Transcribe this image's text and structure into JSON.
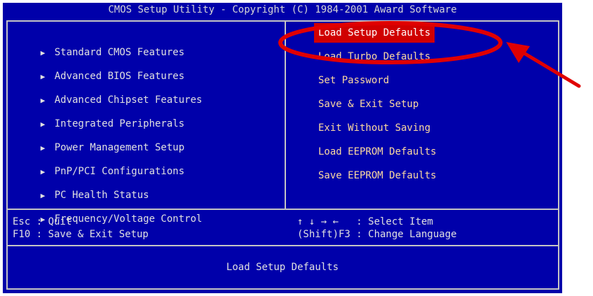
{
  "title": "CMOS Setup Utility - Copyright (C) 1984-2001 Award Software",
  "left_menu": [
    {
      "label": "Standard CMOS Features"
    },
    {
      "label": "Advanced BIOS Features"
    },
    {
      "label": "Advanced Chipset Features"
    },
    {
      "label": "Integrated Peripherals"
    },
    {
      "label": "Power Management Setup"
    },
    {
      "label": "PnP/PCI Configurations"
    },
    {
      "label": "PC Health Status"
    },
    {
      "label": "Frequency/Voltage Control"
    }
  ],
  "submenu_marker": "▶",
  "right_menu": [
    {
      "label": "Load Setup Defaults",
      "selected": true
    },
    {
      "label": "Load Turbo Defaults"
    },
    {
      "label": "Set Password"
    },
    {
      "label": "Save & Exit Setup"
    },
    {
      "label": "Exit Without Saving"
    },
    {
      "label": "Load EEPROM Defaults"
    },
    {
      "label": "Save EEPROM Defaults"
    }
  ],
  "help": {
    "line1_left": "Esc : Quit",
    "line2_left": "F10 : Save & Exit Setup",
    "line1_right": "↑ ↓ → ←   : Select Item",
    "line2_right": "(Shift)F3 : Change Language"
  },
  "status": "Load Setup Defaults",
  "colors": {
    "background": "#0000aa",
    "highlight": "#d00000",
    "annotation": "#e00000",
    "right_text": "#fcd9a0"
  },
  "annotation": {
    "shape": "ellipse-with-arrow",
    "target": "Load Setup Defaults"
  }
}
